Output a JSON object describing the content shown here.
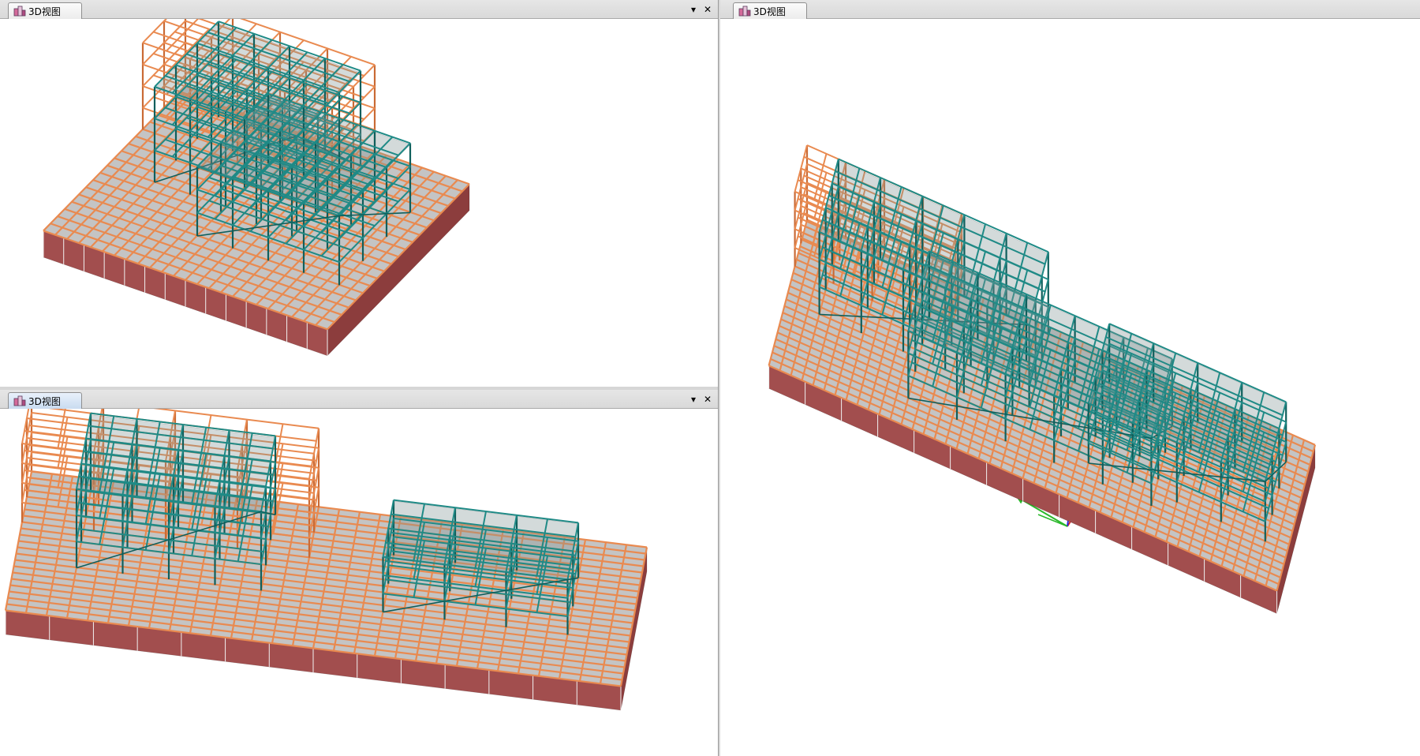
{
  "panes": {
    "top_left": {
      "tab_label": "3D视图",
      "dropdown_glyph": "▾",
      "close_glyph": "✕"
    },
    "bottom_left": {
      "tab_label": "3D视图",
      "dropdown_glyph": "▾",
      "close_glyph": "✕"
    },
    "right": {
      "tab_label": "3D视图"
    }
  },
  "icons": {
    "tab_icon": "3d-view-icon",
    "axis_triad": "coordinate-axis-icon"
  },
  "colors": {
    "concrete": "#e98a50",
    "concrete_dark": "#c96a35",
    "steel": "#1f8a86",
    "steel_dark": "#0f5f5c",
    "wall": "#a24e4e",
    "slab": "#c4c4c4",
    "axis_x": "#e32020",
    "axis_y": "#2bb82b",
    "axis_z": "#2525e0"
  }
}
